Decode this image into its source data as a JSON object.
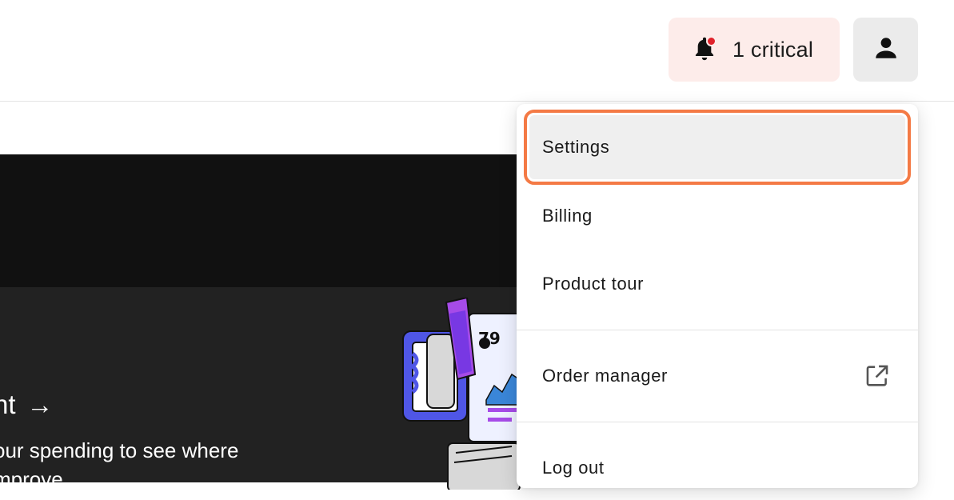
{
  "header": {
    "critical_label": "1 critical",
    "icons": {
      "alerts": "bell-icon",
      "account": "user-icon"
    },
    "colors": {
      "critical_bg": "#fdecea",
      "critical_dot": "#e0222b",
      "account_bg": "#ebebeb"
    }
  },
  "banner": {
    "title_partial": "nt",
    "arrow": "→",
    "desc_line1": "our spending to see where",
    "desc_line2": "mprove",
    "illustration_text": "79"
  },
  "menu": {
    "items": [
      {
        "label": "Settings",
        "active": true
      },
      {
        "label": "Billing"
      },
      {
        "label": "Product tour"
      },
      {
        "label": "Order manager",
        "icon": "external-link-icon"
      },
      {
        "label": "Log out"
      }
    ],
    "focus_color": "#f47a45"
  }
}
